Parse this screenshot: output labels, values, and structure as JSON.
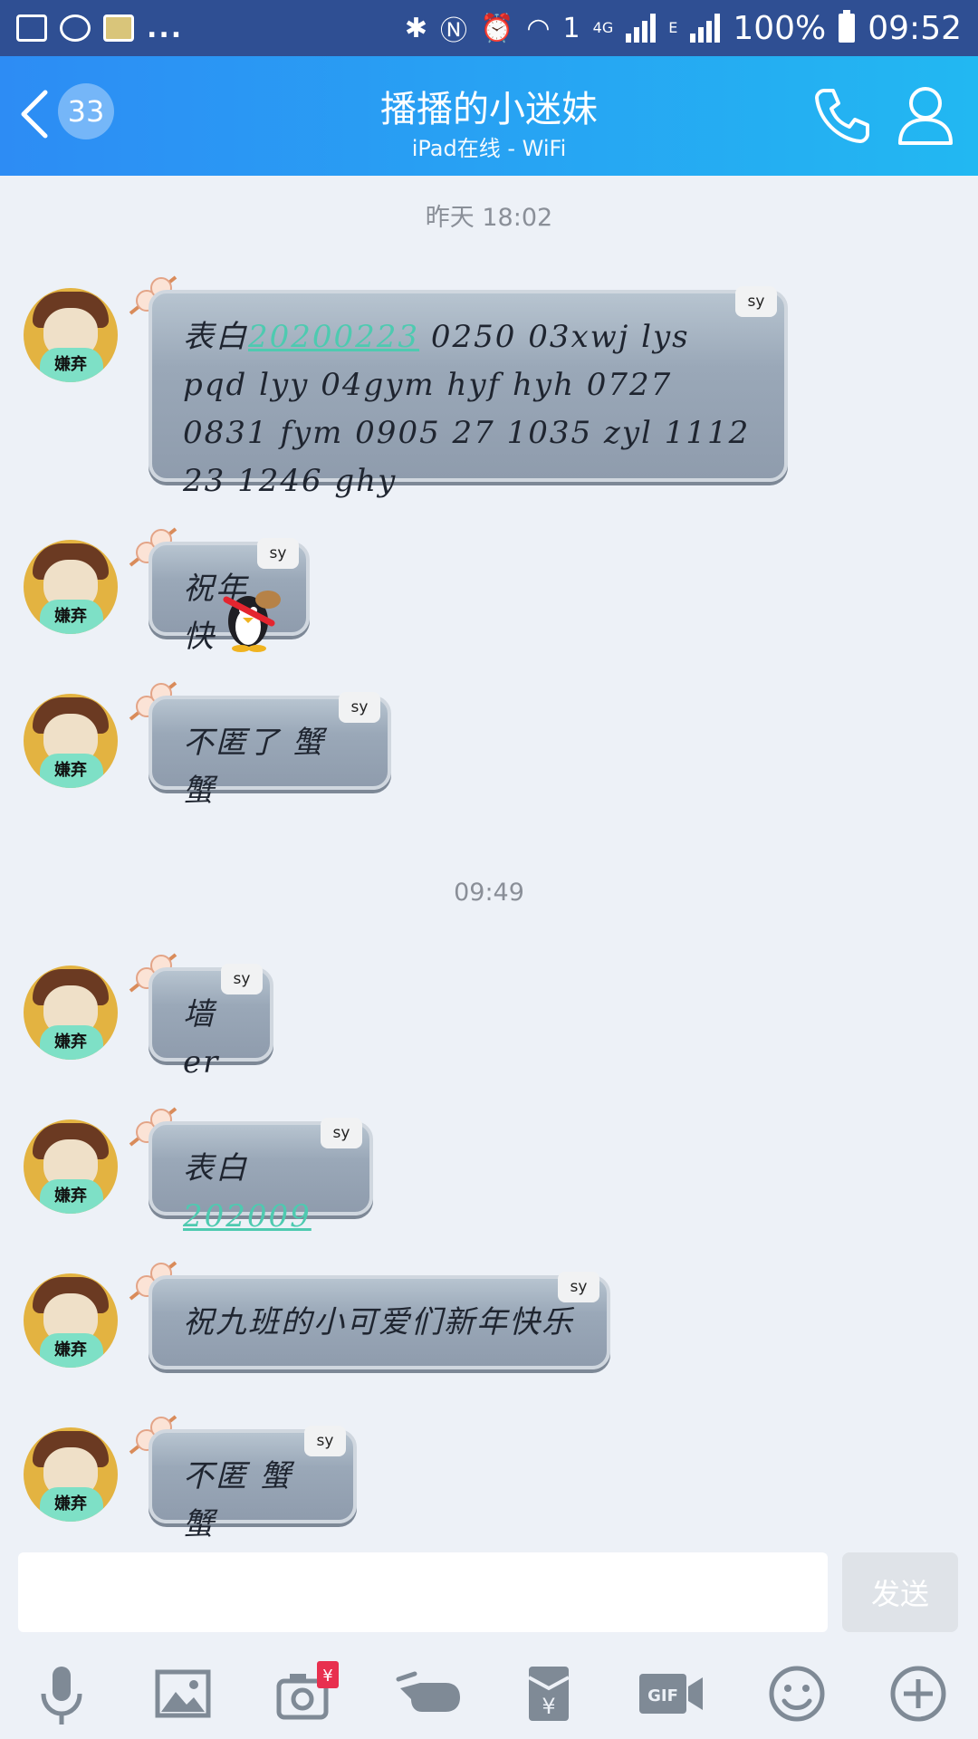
{
  "status_bar": {
    "battery": "100%",
    "time": "09:52",
    "network": "4G",
    "sim": "1",
    "ext": "E",
    "more": "..."
  },
  "header": {
    "unread_count": "33",
    "title": "播播的小迷妹",
    "subtitle": "iPad在线 - WiFi"
  },
  "chat": {
    "time_1": "昨天 18:02",
    "time_2": "09:49",
    "avatar_label": "嫌弃",
    "tag": "sy",
    "messages": [
      {
        "prefix": "表白",
        "link": "20200223",
        "rest": " 0250 03xwj lys pqd lyy 04gym hyf hyh 0727 0831 fym 0905 27 1035 zyl 1112 23 1246 ghy"
      },
      {
        "text": "祝年快"
      },
      {
        "text": "不匿了 蟹蟹"
      },
      {
        "text": "墙er"
      },
      {
        "prefix": "表白",
        "link": "202009"
      },
      {
        "text": "祝九班的小可爱们新年快乐"
      },
      {
        "text": "不匿 蟹蟹"
      }
    ]
  },
  "composer": {
    "send_label": "发送",
    "input_value": ""
  },
  "toolbar": {
    "icons": [
      "microphone-icon",
      "image-icon",
      "camera-redpacket-icon",
      "poke-icon",
      "red-envelope-icon",
      "gif-icon",
      "emoji-icon",
      "plus-icon"
    ],
    "redpacket_badge": "¥"
  },
  "colors": {
    "statusbar": "#2f4f93",
    "header_start": "#2d8cf4",
    "header_end": "#22b8f2",
    "chat_bg": "#edf1f7",
    "link": "#4ecab0"
  }
}
